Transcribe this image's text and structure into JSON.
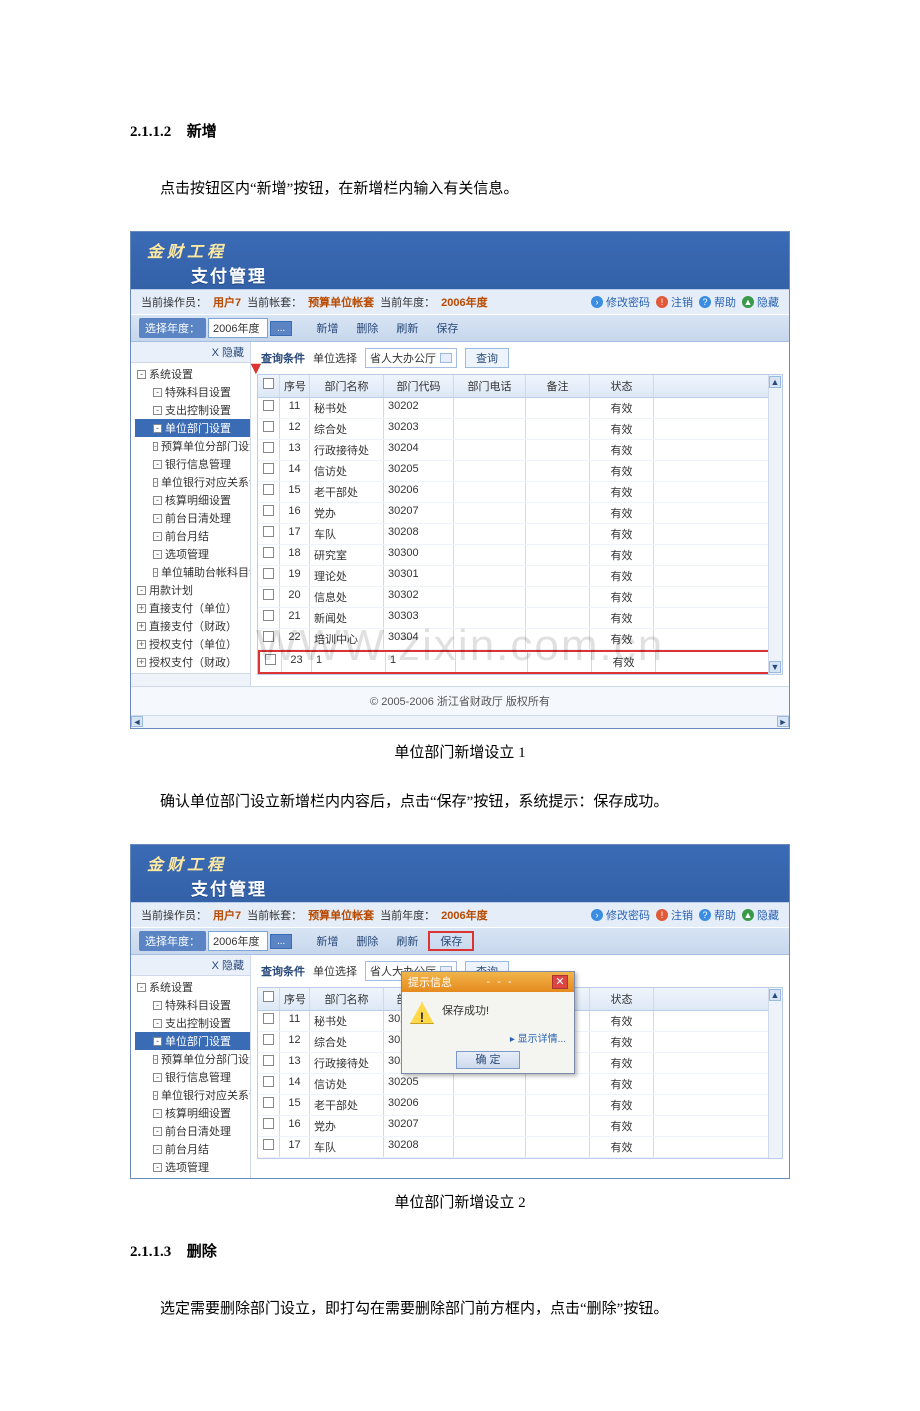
{
  "doc": {
    "sec_add_num": "2.1.1.2",
    "sec_add_title": "新增",
    "para_add": "点击按钮区内“新增”按钮，在新增栏内输入有关信息。",
    "caption1": "单位部门新增设立 1",
    "para_confirm": "确认单位部门设立新增栏内内容后，点击“保存”按钮，系统提示：保存成功。",
    "caption2": "单位部门新增设立 2",
    "sec_del_num": "2.1.1.3",
    "sec_del_title": "删除",
    "para_del": "选定需要删除部门设立，即打勾在需要删除部门前方框内，点击“删除”按钮。",
    "watermark": "WWW.zixin.com.cn"
  },
  "app": {
    "brand1": "金财工程",
    "brand2": "支付管理",
    "operator_label": "当前操作员：",
    "operator": "用户7",
    "acct_label": "当前帐套：",
    "acct": "预算单位帐套",
    "year_label": "当前年度：",
    "year": "2006年度",
    "links": {
      "pwd": "修改密码",
      "logout": "注销",
      "help": "帮助",
      "hide": "隐藏"
    },
    "toolbar": {
      "select_year_label": "选择年度：",
      "select_year_value": "2006年度",
      "more": "...",
      "add": "新增",
      "del": "删除",
      "refresh": "刷新",
      "save": "保存"
    },
    "side": {
      "hide": "X 隐藏",
      "root": "系统设置",
      "items": [
        "特殊科目设置",
        "支出控制设置",
        "单位部门设置",
        "预算单位分部门设置",
        "银行信息管理",
        "单位银行对应关系设置",
        "核算明细设置",
        "前台日清处理",
        "前台月结",
        "选项管理",
        "单位辅助台帐科目设置"
      ],
      "root2": "用款计划",
      "others": [
        "直接支付（单位）",
        "直接支付（财政）",
        "授权支付（单位）",
        "授权支付（财政）"
      ]
    },
    "filter": {
      "cond": "查询条件",
      "unit_label": "单位选择",
      "unit_value": "省人大办公厅",
      "query": "查询"
    },
    "grid": {
      "headers": {
        "seq": "序号",
        "name": "部门名称",
        "code": "部门代码",
        "tel": "部门电话",
        "note": "备注",
        "stat": "状态"
      },
      "rows": [
        {
          "seq": "11",
          "name": "秘书处",
          "code": "30202",
          "stat": "有效"
        },
        {
          "seq": "12",
          "name": "综合处",
          "code": "30203",
          "stat": "有效"
        },
        {
          "seq": "13",
          "name": "行政接待处",
          "code": "30204",
          "stat": "有效"
        },
        {
          "seq": "14",
          "name": "信访处",
          "code": "30205",
          "stat": "有效"
        },
        {
          "seq": "15",
          "name": "老干部处",
          "code": "30206",
          "stat": "有效"
        },
        {
          "seq": "16",
          "name": "党办",
          "code": "30207",
          "stat": "有效"
        },
        {
          "seq": "17",
          "name": "车队",
          "code": "30208",
          "stat": "有效"
        },
        {
          "seq": "18",
          "name": "研究室",
          "code": "30300",
          "stat": "有效"
        },
        {
          "seq": "19",
          "name": "理论处",
          "code": "30301",
          "stat": "有效"
        },
        {
          "seq": "20",
          "name": "信息处",
          "code": "30302",
          "stat": "有效"
        },
        {
          "seq": "21",
          "name": "新闻处",
          "code": "30303",
          "stat": "有效"
        },
        {
          "seq": "22",
          "name": "培训中心",
          "code": "30304",
          "stat": "有效"
        }
      ],
      "new_row": {
        "seq": "23",
        "name": "1",
        "code": "1",
        "stat": "有效"
      }
    },
    "footer": "© 2005-2006 浙江省财政厅 版权所有"
  },
  "dialog": {
    "title": "提示信息",
    "msg": "保存成功!",
    "more": "▸ 显示详情...",
    "ok": "确 定"
  }
}
